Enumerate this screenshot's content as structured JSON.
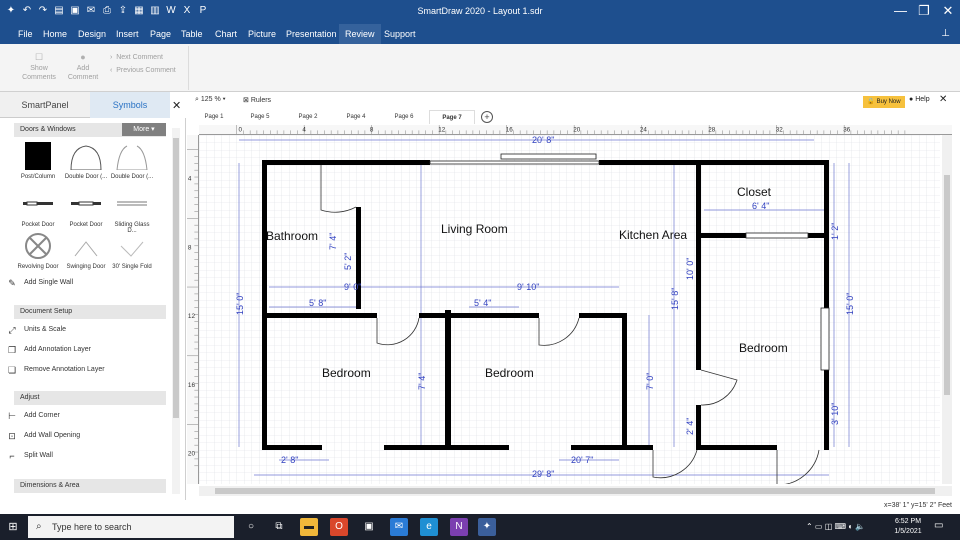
{
  "window": {
    "title": "SmartDraw 2020 - Layout 1.sdr"
  },
  "menu": {
    "items": [
      "File",
      "Home",
      "Design",
      "Insert",
      "Page",
      "Table",
      "Chart",
      "Picture",
      "Presentation",
      "Review",
      "Support"
    ],
    "active": "Review"
  },
  "ribbon": {
    "show_comments": "Show\nComments",
    "add_comment": "Add\nComment",
    "next_comment": "Next Comment",
    "previous_comment": "Previous Comment"
  },
  "left_panel": {
    "tab_smartpanel": "SmartPanel",
    "tab_symbols": "Symbols",
    "library": "Doors & Windows",
    "more": "More",
    "symbols": [
      "Post/Column",
      "Double Door (...",
      "Double Door (...",
      "Pocket Door",
      "Pocket Door",
      "Sliding Glass D...",
      "Revolving Door",
      "Swinging Door",
      "30' Single Fold"
    ],
    "add_single_wall": "Add Single Wall",
    "sections": {
      "document_setup": "Document Setup",
      "adjust": "Adjust",
      "dimensions_area": "Dimensions & Area"
    },
    "document_actions": [
      "Units & Scale",
      "Add Annotation Layer",
      "Remove Annotation Layer"
    ],
    "adjust_actions": [
      "Add Corner",
      "Add Wall Opening",
      "Split Wall"
    ]
  },
  "canvas": {
    "zoom": "125 %",
    "rulers": "Rulers",
    "buy_now": "Buy Now",
    "help": "Help",
    "pages": [
      "Page 1",
      "Page 5",
      "Page 2",
      "Page 4",
      "Page 6",
      "Page 7"
    ],
    "active_page": "Page 7",
    "ruler_h": [
      "0",
      "4",
      "8",
      "12",
      "16",
      "20",
      "24",
      "28",
      "32",
      "36"
    ],
    "ruler_v": [
      "4",
      "8",
      "12",
      "16",
      "20"
    ],
    "status": "x=38' 1\"  y=15' 2\" Feet"
  },
  "floorplan": {
    "rooms": {
      "bathroom": "Bathroom",
      "living_room": "Living Room",
      "kitchen_area": "Kitchen Area",
      "closet": "Closet",
      "bedroom_1": "Bedroom",
      "bedroom_2": "Bedroom",
      "bedroom_3": "Bedroom"
    },
    "dimensions": {
      "top_width": "20' 8\"",
      "closet_width": "6' 4\"",
      "left_height": "15' 0\"",
      "right_height": "15' 0\"",
      "bath_height": "7' 4\"",
      "bath_h2": "5' 2\"",
      "wall_9": "9' 0\"",
      "living_width": "9' 10\"",
      "bed1_width": "5' 8\"",
      "bed2_width": "5' 4\"",
      "mid_height": "15' 8\"",
      "kitchen_h": "10' 0\"",
      "closet_h": "1' 2\"",
      "bed1_height": "7' 4\"",
      "hall_height": "7' 0\"",
      "kitchen_h2": "2' 4\"",
      "bed3_h": "3' 10\"",
      "bottom_left": "2' 8\"",
      "bottom_mid": "20' 7\"",
      "bottom_total": "29' 8\""
    }
  },
  "taskbar": {
    "search_placeholder": "Type here to search",
    "time": "6:52 PM",
    "date": "1/5/2021"
  }
}
